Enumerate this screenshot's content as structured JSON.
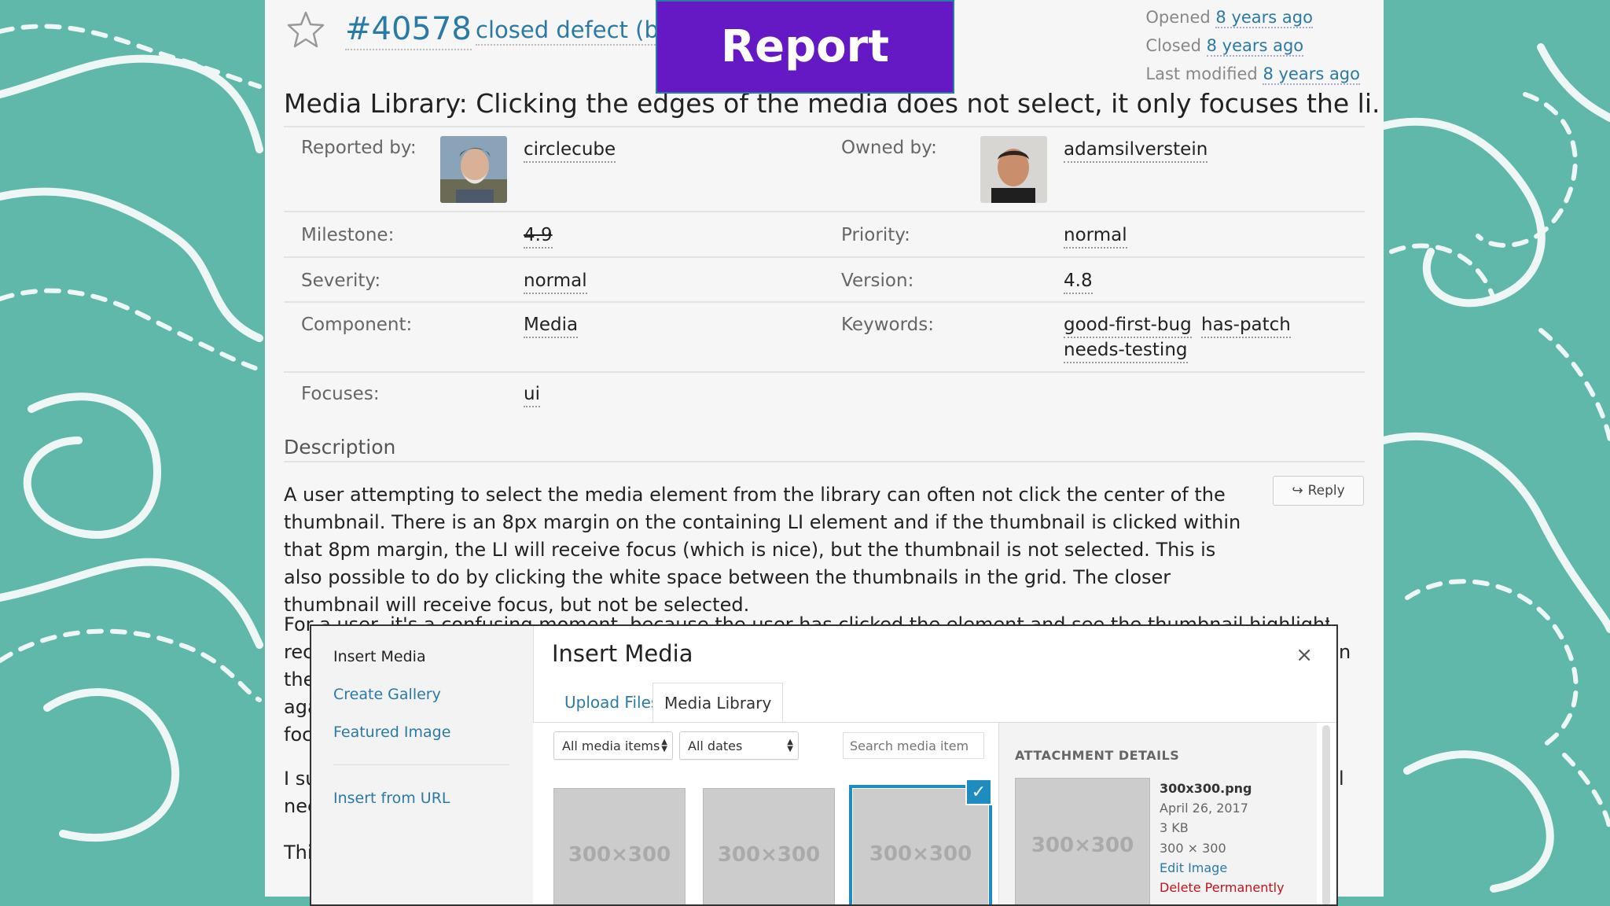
{
  "ticket": {
    "number": "#40578",
    "status": "closed defect (bug)",
    "opened_label": "Opened",
    "opened_value": "8 years ago",
    "closed_label": "Closed",
    "closed_value": "8 years ago",
    "modified_label": "Last modified",
    "modified_value": "8 years ago",
    "summary": "Media Library: Clicking the edges of the media does not select, it only focuses the li."
  },
  "fields": {
    "reported_by_label": "Reported by:",
    "reported_by": "circlecube",
    "owned_by_label": "Owned by:",
    "owned_by": "adamsilverstein",
    "milestone_label": "Milestone:",
    "milestone": "4.9",
    "priority_label": "Priority:",
    "priority": "normal",
    "severity_label": "Severity:",
    "severity": "normal",
    "version_label": "Version:",
    "version": "4.8",
    "component_label": "Component:",
    "component": "Media",
    "keywords_label": "Keywords:",
    "keywords": [
      "good-first-bug",
      "has-patch",
      "needs-testing"
    ],
    "focuses_label": "Focuses:",
    "focuses": "ui"
  },
  "description": {
    "heading": "Description",
    "reply_label": "Reply",
    "paragraph1": "A user attempting to select the media element from the library can often not click the center of the thumbnail. There is an 8px margin on the containing LI element and if the thumbnail is clicked within that 8pm margin, the LI will receive focus (which is nice), but the thumbnail is not selected. This is also possible to do by clicking the white space between the thumbnails in the grid. The closer thumbnail will receive focus, but not be selected.",
    "paragraph2": "For a user, it's a confusing moment, because the user has clicked the element and see the thumbnail highlight since it",
    "fragments": [
      "rec",
      "the",
      "aga",
      "foc",
      "I su",
      "nee",
      "Thi"
    ],
    "right_fragments": [
      "n",
      "l"
    ]
  },
  "overlay": {
    "report_label": "Report",
    "report_color": "#6519c4"
  },
  "modal": {
    "side_title": "Insert Media",
    "side_links": [
      "Create Gallery",
      "Featured Image"
    ],
    "side_url": "Insert from URL",
    "title": "Insert Media",
    "close": "×",
    "tab_upload": "Upload Files",
    "tab_library": "Media Library",
    "filter_type": "All media items",
    "filter_date": "All dates",
    "search_placeholder": "Search media item",
    "thumb_label": "300×300",
    "details_heading": "ATTACHMENT DETAILS",
    "details": {
      "filename": "300x300.png",
      "date": "April 26, 2017",
      "size": "3 KB",
      "dimensions": "300 × 300",
      "edit": "Edit Image",
      "delete": "Delete Permanently"
    }
  },
  "colors": {
    "background_teal": "#5fb8aa",
    "link_blue": "#2a7aa6",
    "select_blue": "#1e8cbe",
    "delete_red": "#c0141a"
  }
}
